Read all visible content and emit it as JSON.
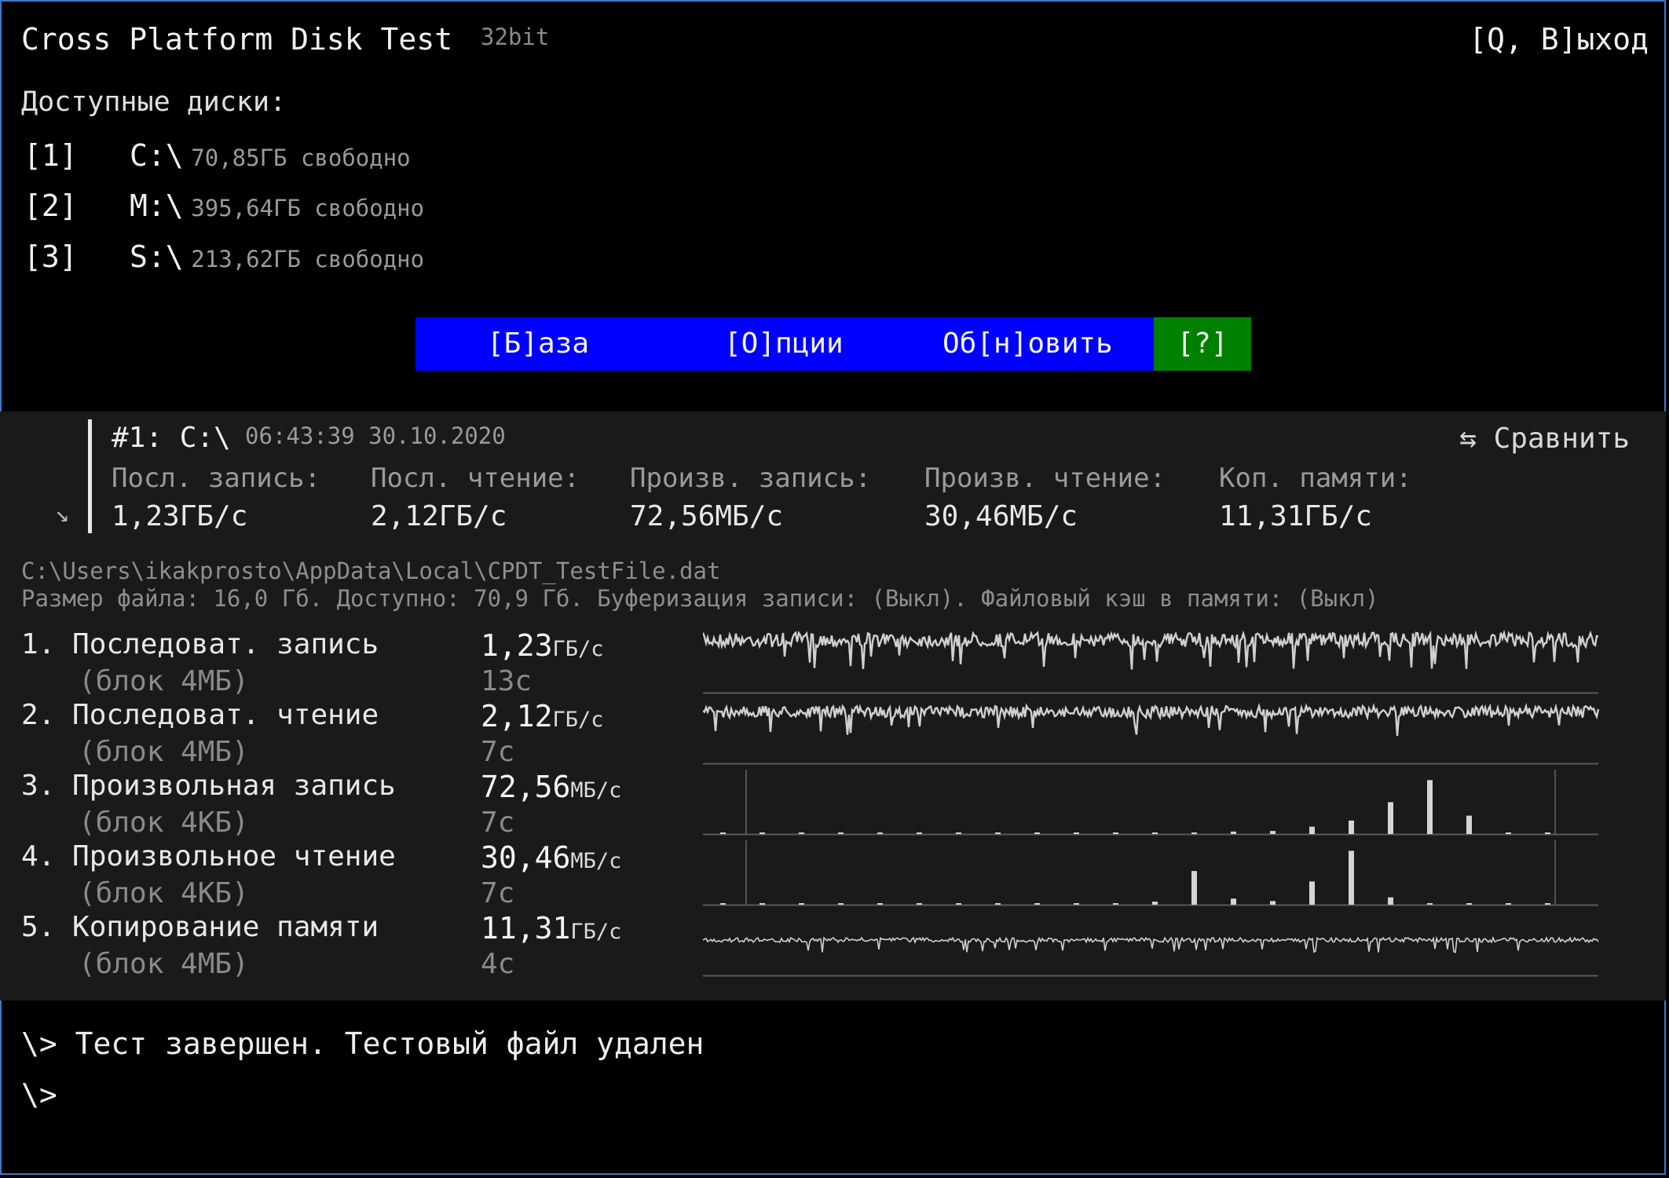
{
  "header": {
    "title": "Cross Platform Disk Test",
    "bits": "32bit",
    "quit": "[Q, В]ыход"
  },
  "drives": {
    "title": "Доступные диски:",
    "items": [
      {
        "key": "[1]",
        "name": "C:\\",
        "free": "70,85ГБ свободно"
      },
      {
        "key": "[2]",
        "name": "M:\\",
        "free": "395,64ГБ свободно"
      },
      {
        "key": "[3]",
        "name": "S:\\",
        "free": "213,62ГБ свободно"
      }
    ]
  },
  "menu": {
    "base": "[Б]аза",
    "options": "[О]пции",
    "refresh": "Об[н]овить",
    "help": "[?]"
  },
  "colors": {
    "menu_bg": "#0000ff",
    "help_bg": "#008000",
    "panel_bg": "#1a1a1a",
    "frame": "#3b78c6"
  },
  "result": {
    "drive": "#1: C:\\",
    "datetime": "06:43:39 30.10.2020",
    "compare": "⇆ Сравнить",
    "arrow_icon": "arrow-down-right",
    "summary": [
      {
        "label": "Посл. запись:",
        "value": "1,23ГБ/с"
      },
      {
        "label": "Посл. чтение:",
        "value": "2,12ГБ/с"
      },
      {
        "label": "Произв. запись:",
        "value": "72,56МБ/с"
      },
      {
        "label": "Произв. чтение:",
        "value": "30,46МБ/с"
      },
      {
        "label": "Коп. памяти:",
        "value": "11,31ГБ/с"
      }
    ]
  },
  "file": {
    "path": "C:\\Users\\ikakprosto\\AppData\\Local\\CPDT_TestFile.dat",
    "info": "Размер файла: 16,0 Гб. Доступно: 70,9 Гб. Буферизация записи: (Выкл). Файловый кэш в памяти: (Выкл)"
  },
  "tests": [
    {
      "name": "1. Последоват. запись",
      "block": "(блок 4МБ)",
      "value": "1,23",
      "unit": "ГБ/с",
      "time": "13с",
      "graph": "noise",
      "level": 0.82,
      "spread": 0.22
    },
    {
      "name": "2. Последоват. чтение",
      "block": "(блок 4МБ)",
      "value": "2,12",
      "unit": "ГБ/с",
      "time": "7с",
      "graph": "noise",
      "level": 0.8,
      "spread": 0.18
    },
    {
      "name": "3. Произвольная запись",
      "block": "(блок 4КБ)",
      "value": "72,56",
      "unit": "МБ/с",
      "time": "7с",
      "graph": "bars",
      "bars": [
        0.02,
        0.02,
        0.02,
        0.02,
        0.02,
        0.02,
        0.02,
        0.02,
        0.02,
        0.02,
        0.02,
        0.02,
        0.02,
        0.04,
        0.05,
        0.12,
        0.22,
        0.52,
        0.88,
        0.3,
        0.02,
        0.02
      ]
    },
    {
      "name": "4. Произвольное чтение",
      "block": "(блок 4КБ)",
      "value": "30,46",
      "unit": "МБ/с",
      "time": "7с",
      "graph": "bars",
      "bars": [
        0.02,
        0.02,
        0.02,
        0.02,
        0.02,
        0.02,
        0.02,
        0.02,
        0.02,
        0.02,
        0.02,
        0.05,
        0.55,
        0.1,
        0.06,
        0.38,
        0.88,
        0.12,
        0.02,
        0.02,
        0.02,
        0.02
      ]
    },
    {
      "name": "5. Копирование памяти",
      "block": "(блок 4МБ)",
      "value": "11,31",
      "unit": "ГБ/с",
      "time": "4с",
      "graph": "line",
      "level": 0.55,
      "spread": 0.1
    }
  ],
  "console": {
    "line1": "\\> Тест завершен. Тестовый файл удален",
    "line2": "\\>"
  }
}
